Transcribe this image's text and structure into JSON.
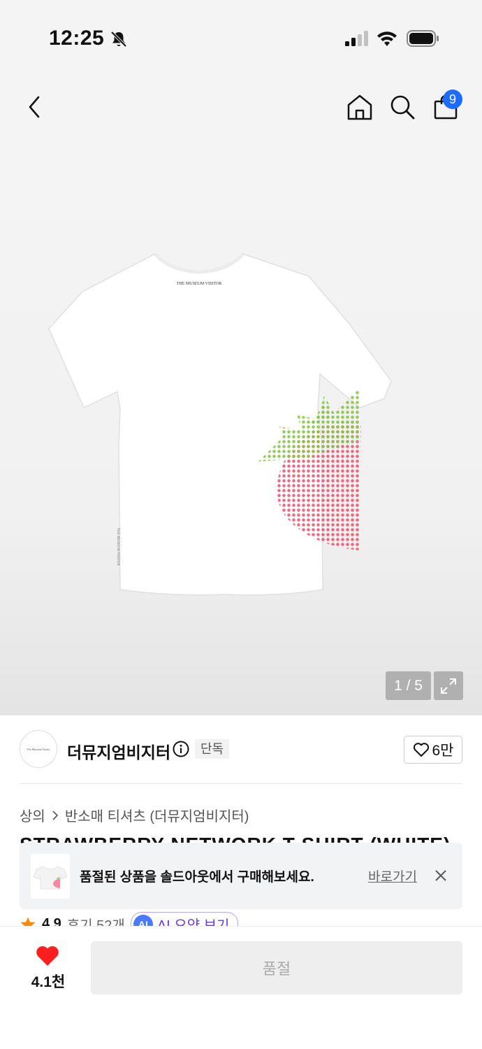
{
  "status_bar": {
    "time": "12:25"
  },
  "header": {
    "cart_count": "9"
  },
  "product_image": {
    "counter": "1 / 5",
    "neck_label": "THE MUSEUM VISITOR",
    "side_label": "THE MUSEUM VISITOR"
  },
  "brand": {
    "logo_text": "The Museum Visitor",
    "name": "더뮤지엄비지터",
    "tag": "단독",
    "likes": "6만"
  },
  "breadcrumb": [
    "상의",
    "반소매 티셔츠 (더뮤지엄비지터)"
  ],
  "product": {
    "title": "STRAWBERRY NETWORK T-SHIRT (WHITE)"
  },
  "banner": {
    "message": "품절된 상품을 솔드아웃에서 구매해보세요.",
    "link": "바로가기"
  },
  "rating": {
    "score": "4.9",
    "reviews": "후기 52개",
    "ai_badge": "AI",
    "ai_label": "AI 요약 보기"
  },
  "bottom_bar": {
    "wish_count": "4.1천",
    "soldout_label": "품절"
  },
  "colors": {
    "accent": "#1e6bff",
    "heart": "#ff1f1f",
    "star": "#ff8a00",
    "ai_purple": "#6a3bde"
  }
}
